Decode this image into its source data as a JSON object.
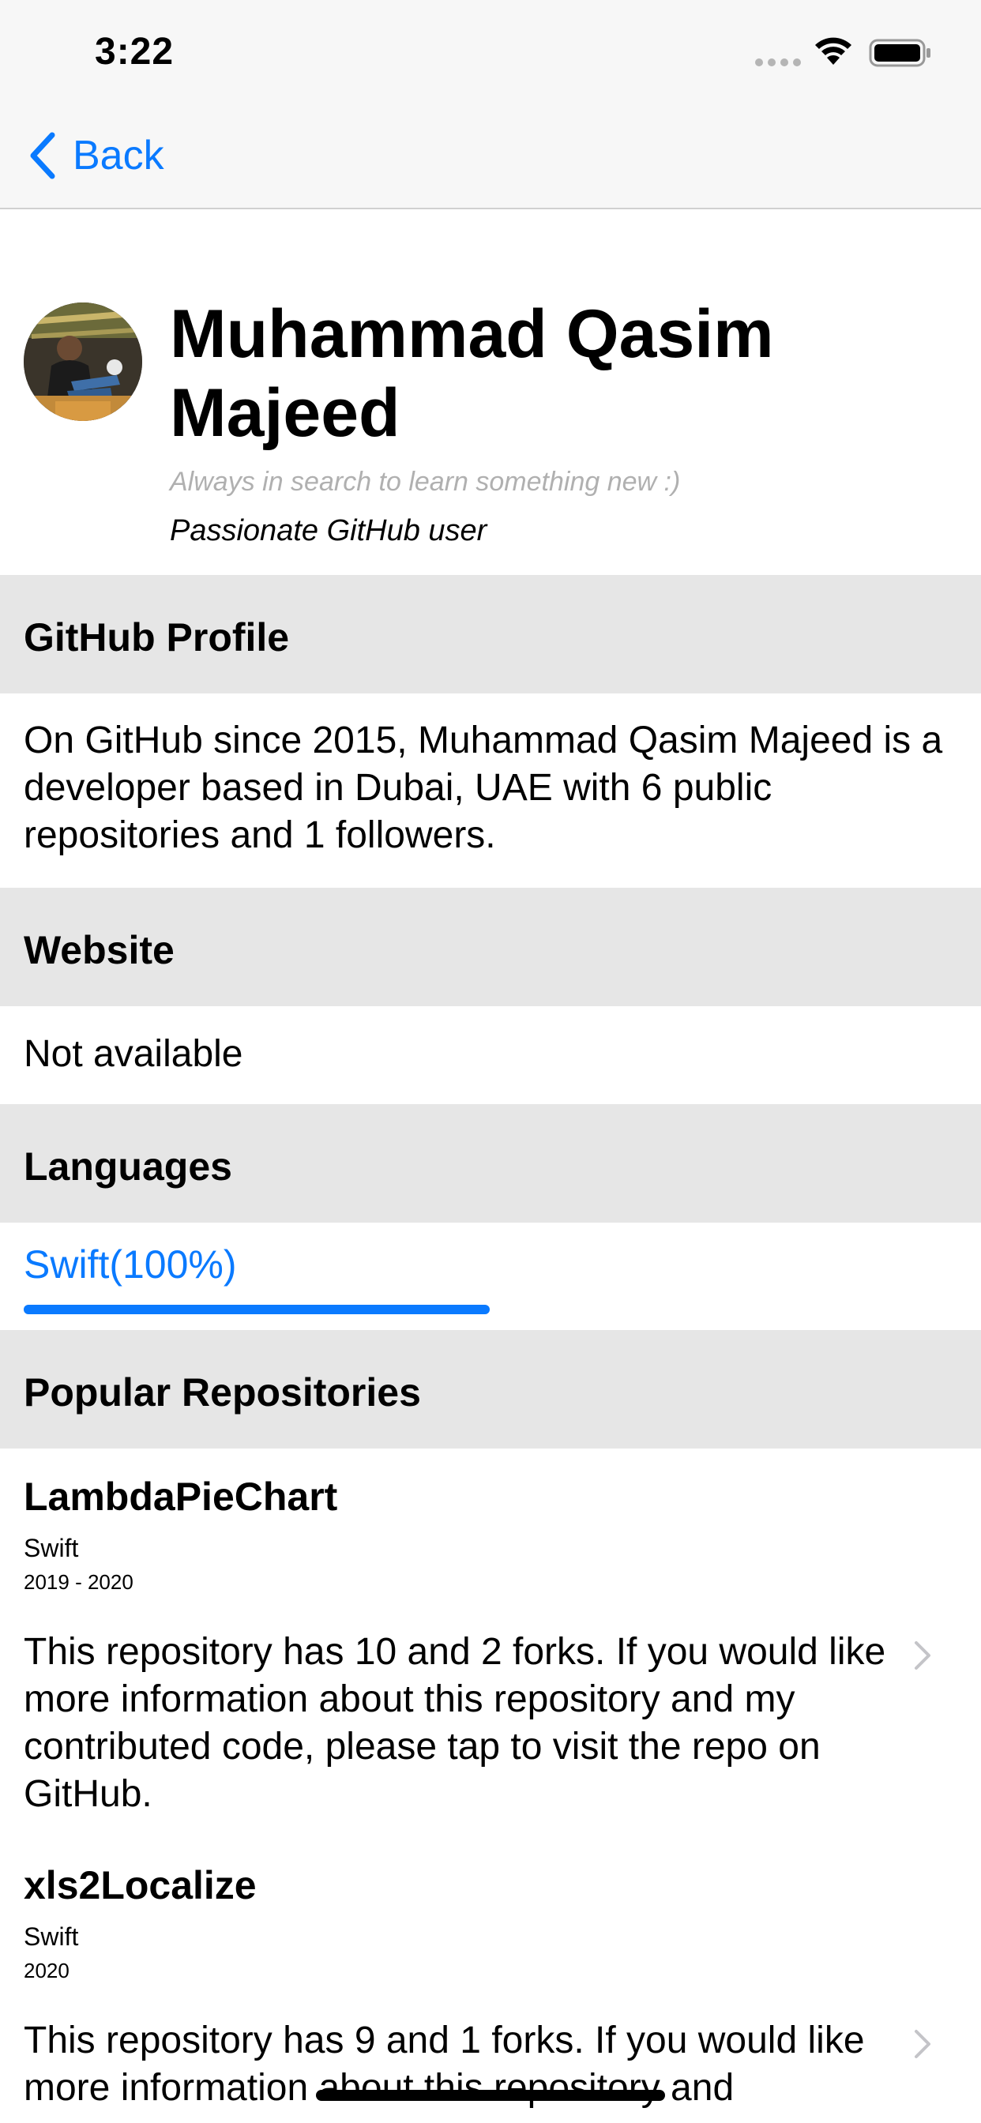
{
  "status_bar": {
    "time": "3:22"
  },
  "nav": {
    "back_label": "Back"
  },
  "profile": {
    "name": "Muhammad Qasim Majeed",
    "bio": "Always in search to learn something new :)",
    "tagline": "Passionate GitHub user"
  },
  "sections": {
    "github_profile": {
      "title": "GitHub Profile",
      "text": "On GitHub since 2015, Muhammad Qasim Majeed is a developer based in Dubai, UAE with 6 public repositories and 1 followers."
    },
    "website": {
      "title": "Website",
      "text": "Not available"
    },
    "languages": {
      "title": "Languages",
      "items": [
        {
          "label": "Swift(100%)",
          "percent": 100
        }
      ]
    },
    "popular_repositories": {
      "title": "Popular Repositories",
      "items": [
        {
          "name": "LambdaPieChart",
          "language": "Swift",
          "years": "2019 - 2020",
          "description": "This repository has 10 and 2 forks. If you would like more information about this repository and my contributed code, please tap to visit the repo on GitHub."
        },
        {
          "name": "xls2Localize",
          "language": "Swift",
          "years": "2020",
          "description": "This repository has 9 and 1 forks. If you would like more information about this repository and"
        }
      ]
    }
  },
  "colors": {
    "accent": "#0a7aff",
    "section_bg": "#e6e6e6",
    "bar_bg": "#f7f7f7"
  },
  "icons": {
    "back": "chevron-left-icon",
    "row": "chevron-right-icon"
  }
}
